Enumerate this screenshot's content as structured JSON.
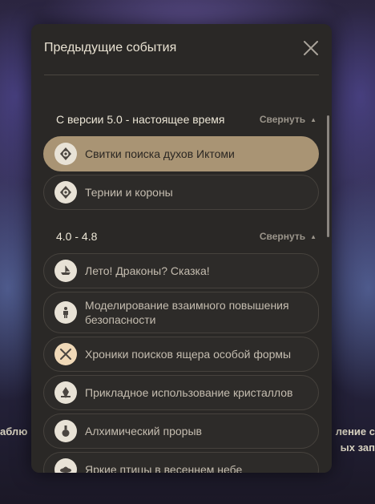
{
  "background": {
    "left_text_1": "аблю",
    "left_text_2": "",
    "right_text_1": "ление с",
    "right_text_2": "ых зап"
  },
  "modal": {
    "title": "Предыдущие события",
    "close_icon": "close-icon"
  },
  "sections": [
    {
      "title": "С версии 5.0 - настоящее время",
      "collapse_label": "Свернуть",
      "items": [
        {
          "label": "Свитки поиска духов Иктоми",
          "icon": "spiral-eye-icon",
          "active": true
        },
        {
          "label": "Тернии и короны",
          "icon": "spiral-eye-icon",
          "active": false
        }
      ]
    },
    {
      "title": "4.0 - 4.8",
      "collapse_label": "Свернуть",
      "items": [
        {
          "label": "Лето! Драконы? Сказка!",
          "icon": "ship-icon",
          "active": false
        },
        {
          "label": "Моделирование взаимного повышения безопасности",
          "icon": "figure-icon",
          "active": false
        },
        {
          "label": "Хроники поисков ящера особой формы",
          "icon": "crossed-swords-icon",
          "active": false
        },
        {
          "label": "Прикладное использование кристаллов",
          "icon": "crystal-icon",
          "active": false
        },
        {
          "label": "Алхимический прорыв",
          "icon": "flask-icon",
          "active": false
        },
        {
          "label": "Яркие птицы в весеннем небе",
          "icon": "ufo-icon",
          "active": false
        }
      ]
    }
  ],
  "colors": {
    "panel": "#2a2826",
    "active_item": "#a99474",
    "text": "#e9e2d2",
    "muted": "#9b958b"
  }
}
